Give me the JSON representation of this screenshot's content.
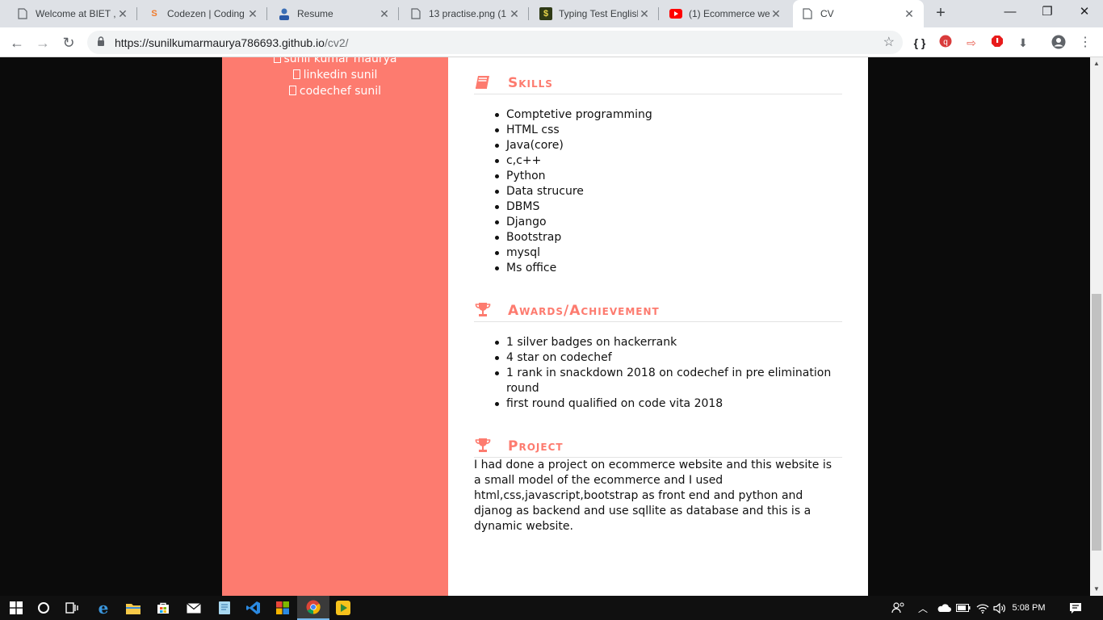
{
  "browser": {
    "tabs": [
      {
        "title": "Welcome at BIET ,",
        "icon": "page-icon"
      },
      {
        "title": "Codezen | Coding",
        "icon": "codezen-icon"
      },
      {
        "title": "Resume",
        "icon": "resume-avatar-icon"
      },
      {
        "title": "13 practise.png (1",
        "icon": "page-icon"
      },
      {
        "title": "Typing Test English",
        "icon": "typing-test-icon"
      },
      {
        "title": "(1) Ecommerce we",
        "icon": "youtube-icon"
      },
      {
        "title": "CV",
        "icon": "page-icon"
      }
    ],
    "url_host": "https://sunilkumarmaurya786693.github.io",
    "url_path": "/cv2/"
  },
  "sidebar": {
    "links": [
      {
        "text": "sunil kumar maurya"
      },
      {
        "text": "linkedin sunil"
      },
      {
        "text": "codechef sunil"
      }
    ]
  },
  "skills": {
    "title": "Skills",
    "items": [
      "Comptetive programming",
      "HTML css",
      "Java(core)",
      "c,c++",
      "Python",
      "Data strucure",
      "DBMS",
      "Django",
      "Bootstrap",
      "mysql",
      "Ms office"
    ]
  },
  "awards": {
    "title": "Awards/Achievement",
    "items": [
      "1 silver badges on hackerrank",
      "4 star on codechef",
      "1 rank in snackdown 2018 on codechef in pre elimination round",
      "first round qualified on code vita 2018"
    ]
  },
  "project": {
    "title": "Project",
    "text": "I had done a project on ecommerce website and this website is a small model of the ecommerce and I used html,css,javascript,bootstrap as front end and python and djanog as backend and use sqllite as database and this is a dynamic website."
  },
  "taskbar": {
    "clock": "5:08 PM"
  },
  "colors": {
    "accent": "#fd7b6f",
    "sidebar_bg": "#fd7b6f",
    "page_bg": "#0b0b0b"
  }
}
